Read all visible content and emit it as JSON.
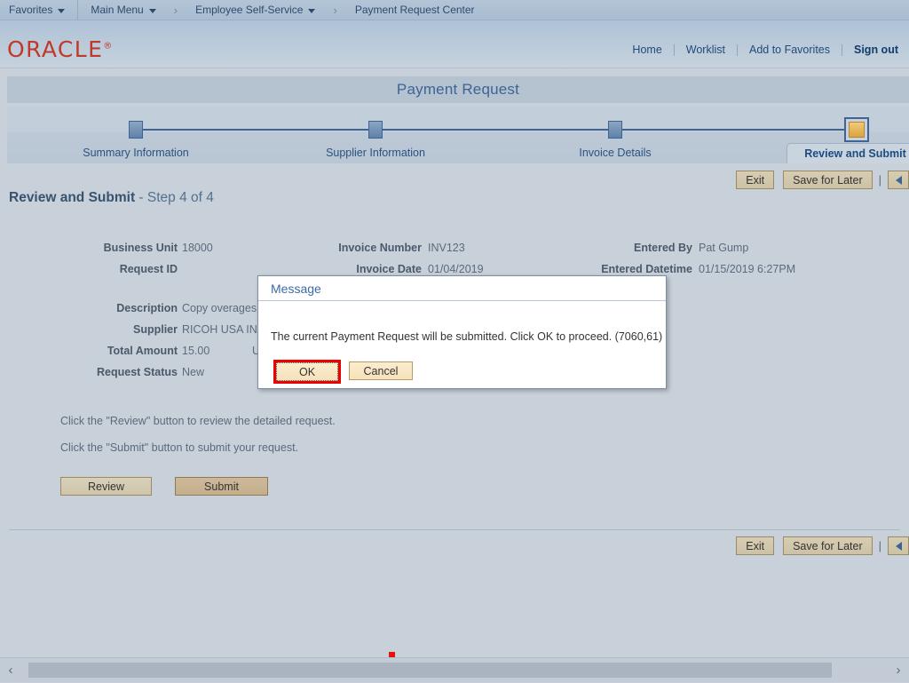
{
  "breadcrumb": {
    "favorites": "Favorites",
    "main_menu": "Main Menu",
    "sep1": "›",
    "employee_self_service": "Employee Self-Service",
    "sep2": "›",
    "current": "Payment Request Center"
  },
  "header": {
    "logo": "ORACLE",
    "logo_tm": "®",
    "links": {
      "home": "Home",
      "worklist": "Worklist",
      "add_to_favorites": "Add to Favorites",
      "sign_out": "Sign out"
    }
  },
  "page": {
    "title": "Payment Request",
    "heading_title": "Review and Submit",
    "heading_sub": " - Step 4 of 4"
  },
  "wizard": {
    "steps": [
      {
        "label": "Summary Information",
        "state": "done"
      },
      {
        "label": "Supplier Information",
        "state": "done"
      },
      {
        "label": "Invoice Details",
        "state": "done"
      },
      {
        "label": "Review and Submit",
        "state": "active"
      }
    ]
  },
  "toolbar": {
    "exit": "Exit",
    "save_for_later": "Save for Later",
    "separator": "|",
    "prev_icon": "previous-arrow-icon"
  },
  "fields": {
    "col1": [
      {
        "label": "Business Unit",
        "value": "18000"
      },
      {
        "label": "Request ID",
        "value": ""
      },
      {
        "label": "Description",
        "value": "Copy overages"
      },
      {
        "label": "Supplier",
        "value": "RICOH USA INC"
      },
      {
        "label": "Total Amount",
        "value": "15.00"
      },
      {
        "label": "Request Status",
        "value": "New"
      }
    ],
    "col2": [
      {
        "label": "Invoice Number",
        "value": "INV123"
      },
      {
        "label": "Invoice Date",
        "value": "01/04/2019"
      }
    ],
    "col3": [
      {
        "label": "Entered By",
        "value": "Pat Gump"
      },
      {
        "label": "Entered Datetime",
        "value": "01/15/2019  6:27PM"
      }
    ],
    "currency": "USD"
  },
  "instructions": {
    "line1": "Click the \"Review\" button to review the detailed request.",
    "line2": "Click the \"Submit\" button to submit your request."
  },
  "actions": {
    "review": "Review",
    "submit": "Submit"
  },
  "dialog": {
    "title": "Message",
    "message": "The current Payment Request will be submitted. Click OK to proceed. (7060,61)",
    "ok": "OK",
    "cancel": "Cancel"
  },
  "scrollbar": {
    "left_arrow": "‹",
    "right_arrow": "›"
  },
  "colors": {
    "oracle_red": "#c0392b",
    "accent_blue": "#2b5280",
    "active_step_gold": "#d9a441",
    "highlight_red": "#ee0000",
    "page_bg": "#c8d0da"
  }
}
